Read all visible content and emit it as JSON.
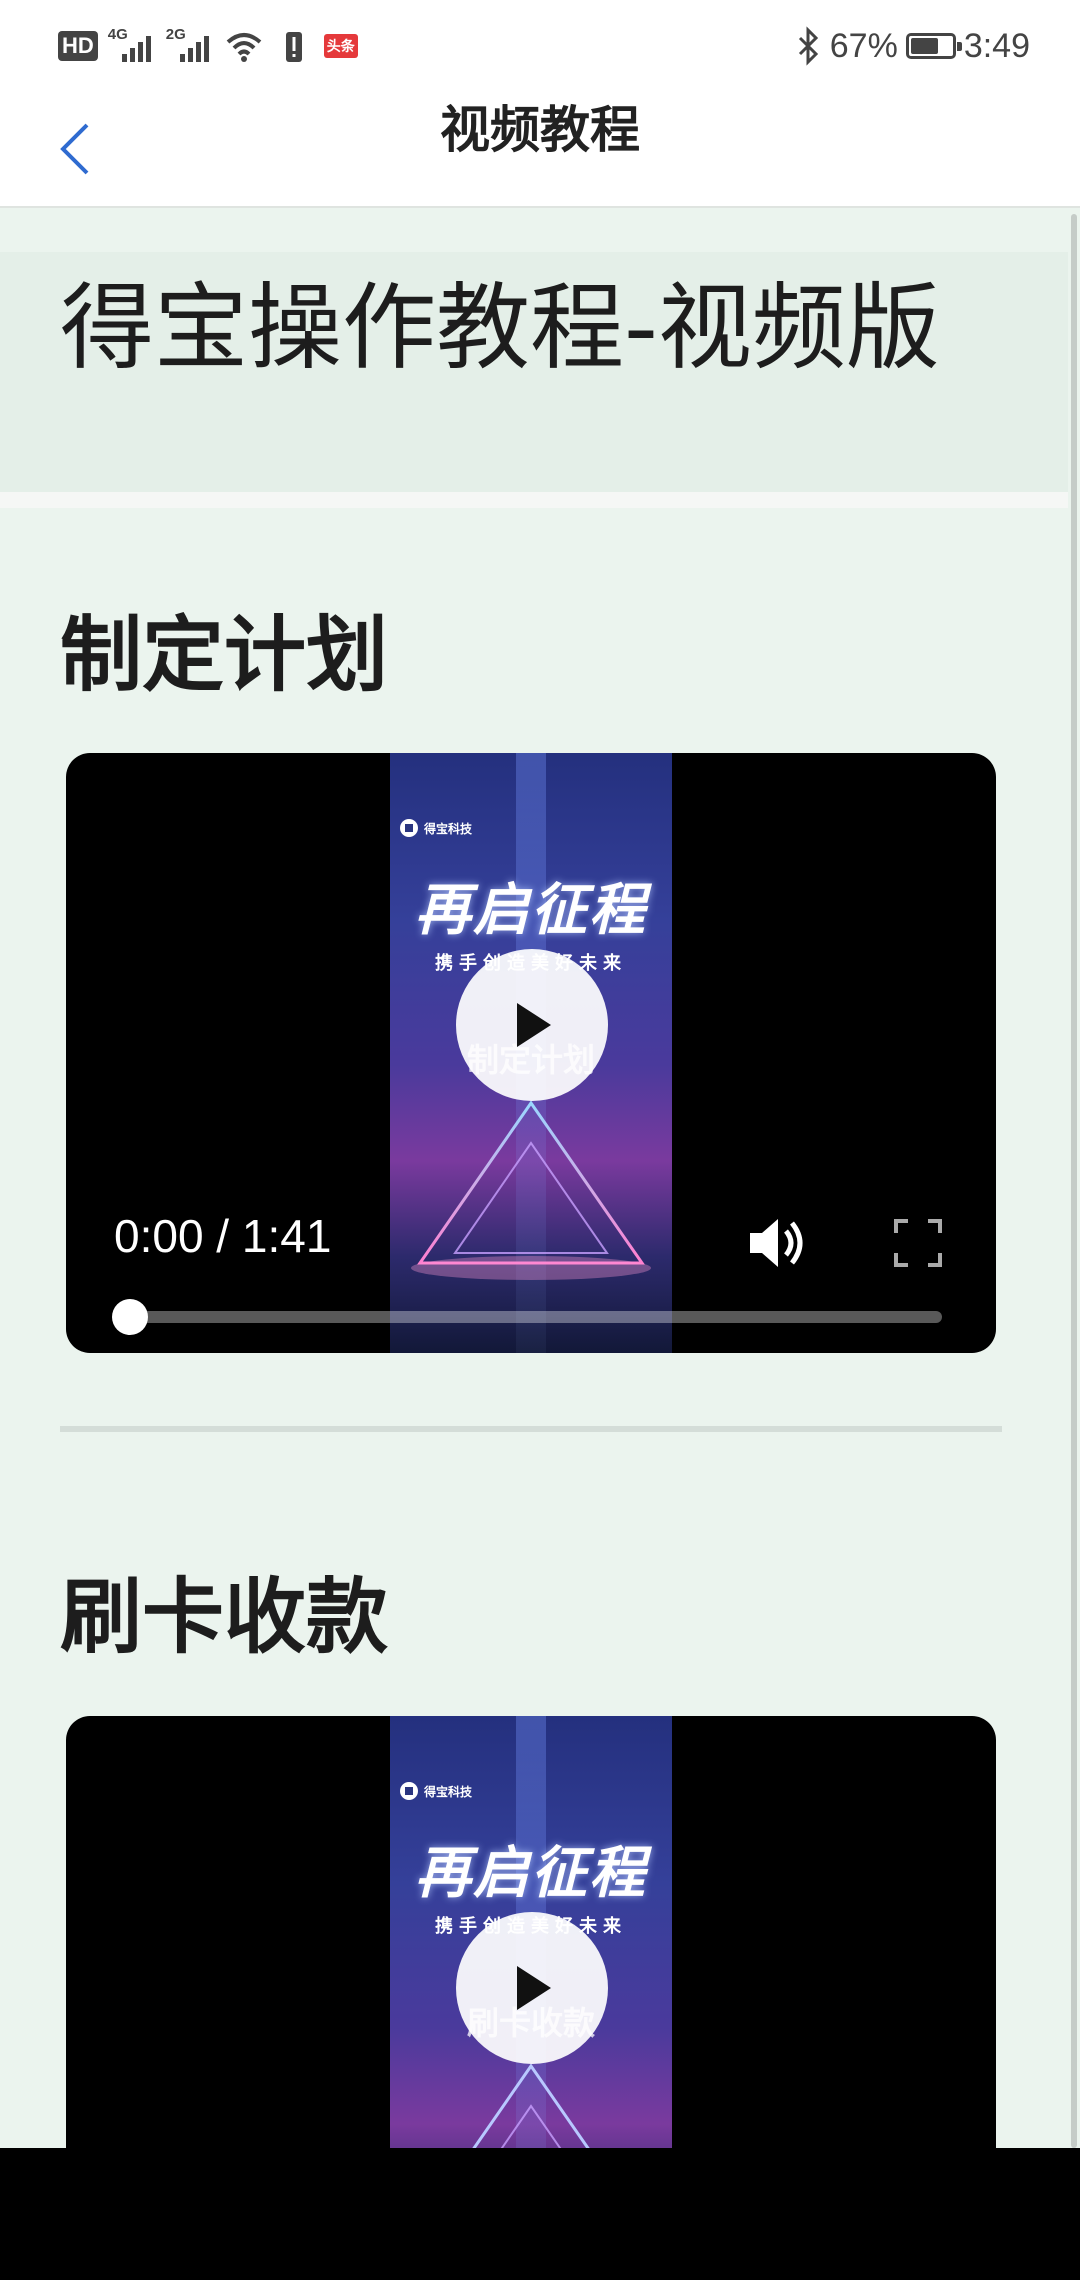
{
  "status_bar": {
    "hd": "HD",
    "signal1": "4G",
    "signal2": "2G",
    "app_badge": "头条",
    "battery_percent": "67%",
    "battery_level": 0.67,
    "time": "3:49",
    "icons": [
      "signal-icon",
      "wifi-icon",
      "alert-icon",
      "bluetooth-icon",
      "battery-icon"
    ]
  },
  "nav": {
    "title": "视频教程",
    "back_icon": "chevron-left-icon",
    "accent_color": "#2f6bd0"
  },
  "page": {
    "heading": "得宝操作教程-视频版"
  },
  "sections": [
    {
      "title": "制定计划",
      "video": {
        "brand": "得宝科技",
        "headline": "再启征程",
        "tagline": "携手创造美好未来",
        "caption": "制定计划",
        "time": "0:00 / 1:41",
        "progress": 0
      }
    },
    {
      "title": "刷卡收款",
      "video": {
        "brand": "得宝科技",
        "headline": "再启征程",
        "tagline": "携手创造美好未来",
        "caption": "刷卡收款"
      }
    }
  ]
}
